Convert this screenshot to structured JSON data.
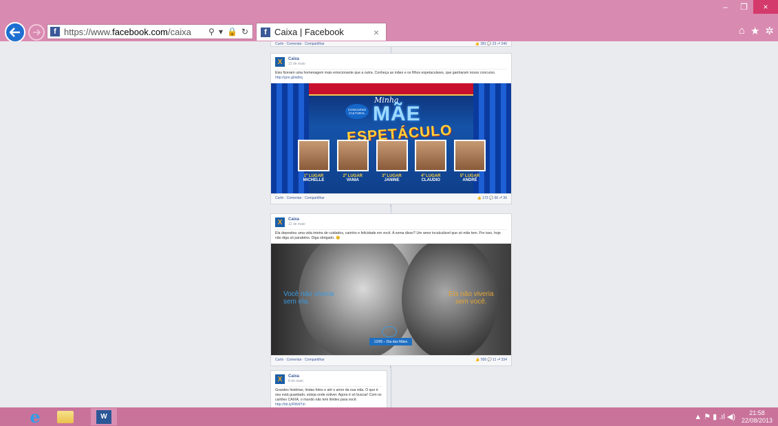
{
  "browser": {
    "url_prefix": "https://www.",
    "url_domain": "facebook.com",
    "url_path": "/caixa",
    "tab_title": "Caixa | Facebook",
    "tab_close": "×",
    "window_controls": {
      "minimize": "–",
      "restore": "❐",
      "close": "×"
    },
    "right_icons": {
      "home": "⌂",
      "favorites": "★",
      "settings": "✲"
    }
  },
  "feed": {
    "top_actions": {
      "links": "Curtir · Comentar · Compartilhar",
      "stats": "👍 281 💬 23 ⮐ 240"
    },
    "posts": [
      {
        "author": "Caixa",
        "date": "12 de maio",
        "text": "Eles fizeram uma homenagem mais emocionante que a outra. Conheça as mães e os filhos espetaculares, que ganharam nosso concurso.",
        "link": "http://goo.gl/adkq",
        "image": {
          "title_line1": "Minha",
          "title_line2": "MÃE",
          "title_line3": "ESPETÁCULO",
          "badge": "CONCURSO CULTURAL",
          "finalists": [
            {
              "place": "1º LUGAR",
              "name": "MICHELLE"
            },
            {
              "place": "2º LUGAR",
              "name": "VANIA"
            },
            {
              "place": "3º LUGAR",
              "name": "JANINE"
            },
            {
              "place": "4º LUGAR",
              "name": "CLAUDIO"
            },
            {
              "place": "5º LUGAR",
              "name": "ANDRÉ"
            }
          ]
        },
        "actions": "Curtir · Comentar · Compartilhar",
        "stats": "👍 173 💬 96 ⮐ 36"
      },
      {
        "author": "Caixa",
        "date": "12 de maio",
        "text": "Ela depositou uma vida inteira de cuidados, carinho e felicidade em você. A soma disso? Um amor incalculável que só mãe tem. Por isso, hoje não diga só parabéns. Diga obrigado. 😊",
        "image": {
          "slogan_left_1": "Você não viveria",
          "slogan_left_2": "sem ela.",
          "slogan_right_1": "Ela não viveria",
          "slogan_right_2": "sem você.",
          "date_ribbon": "12/05 – Dia das Mães"
        },
        "actions": "Curtir · Comentar · Compartilhar",
        "stats": "👍 505 💬 11 ⮐ 334"
      },
      {
        "author": "Caixa",
        "date": "8 de maio",
        "text": "Grandes histórias, lindas fotos e até o amor da sua vida. O que é seu está guardado, esteja onde estiver. Agora é só buscar! Com os cartões CAIXA, o mundo não tem limites para você.",
        "link": "http://bit.ly/RWdTm"
      }
    ]
  },
  "taskbar": {
    "word_label": "W",
    "tray_icons": "▲ ⚑ ▮ .ıl ◀)",
    "time": "21:58",
    "date": "22/08/2013"
  },
  "colors": {
    "chrome": "#d98ab0",
    "taskbar": "#c9739b",
    "facebook_blue": "#3b5998",
    "caixa_blue": "#1a5fa8",
    "caixa_orange": "#f8a51c"
  }
}
